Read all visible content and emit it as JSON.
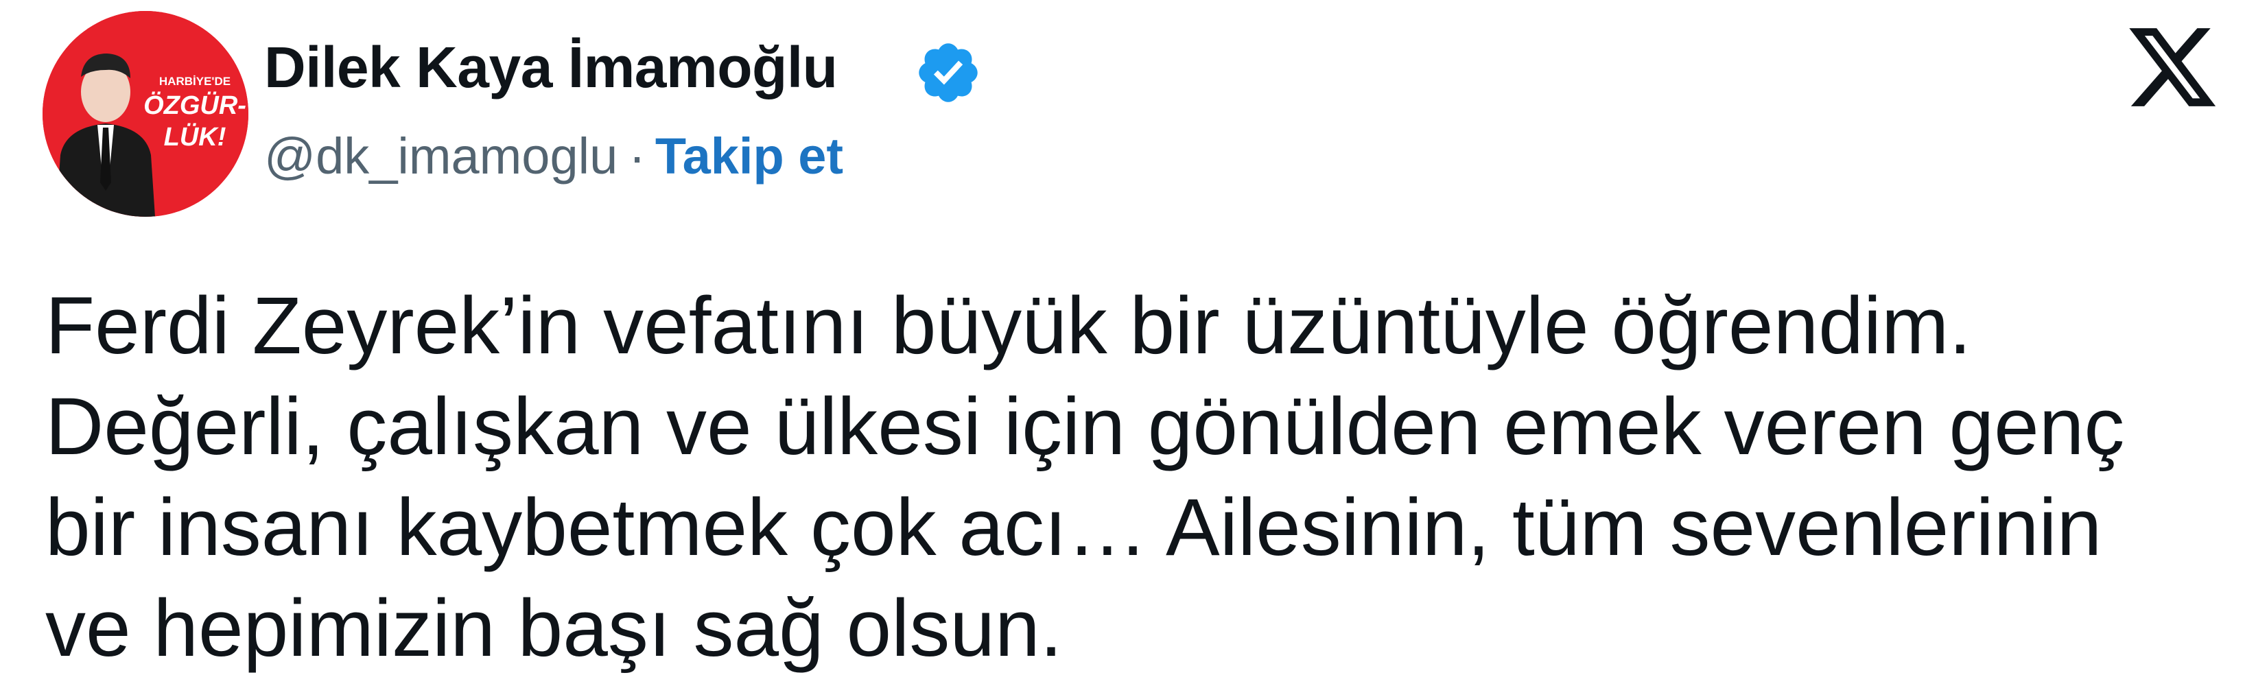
{
  "author": {
    "display_name": "Dilek Kaya İmamoğlu",
    "handle": "@dk_imamoglu",
    "separator": "·",
    "follow_label": "Takip et",
    "verified_icon": "verified-badge-icon",
    "avatar_text": [
      "HARBİYE'DE",
      "ÖZGÜR-",
      "LÜK!"
    ]
  },
  "platform": {
    "logo_icon": "x-logo-icon"
  },
  "tweet": {
    "lines": [
      "Ferdi Zeyrek’in vefatını büyük bir üzüntüyle öğrendim.",
      "Değerli, çalışkan ve ülkesi için gönülden emek veren genç",
      "bir insanı kaybetmek çok acı… Ailesinin, tüm sevenlerinin",
      "ve hepimizin başı sağ olsun."
    ]
  },
  "colors": {
    "text": "#0f1419",
    "muted": "#536471",
    "link": "#1d74c2",
    "verified": "#1d9bf0",
    "avatar_bg": "#e8212b"
  }
}
